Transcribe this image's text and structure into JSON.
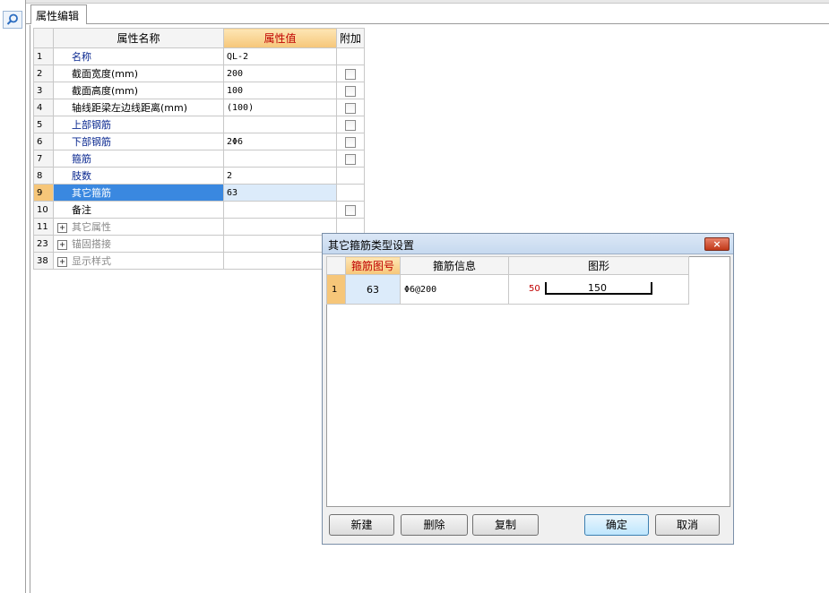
{
  "tab": {
    "label": "属性编辑"
  },
  "grid": {
    "headers": {
      "row": "",
      "name": "属性名称",
      "value": "属性值",
      "extra": "附加"
    },
    "rows": [
      {
        "no": "1",
        "name": "名称",
        "value": "QL-2",
        "checkbox": false
      },
      {
        "no": "2",
        "name": "截面宽度(mm)",
        "value": "200",
        "checkbox": true
      },
      {
        "no": "3",
        "name": "截面高度(mm)",
        "value": "100",
        "checkbox": true
      },
      {
        "no": "4",
        "name": "轴线距梁左边线距离(mm)",
        "value": "(100)",
        "checkbox": true
      },
      {
        "no": "5",
        "name": "上部钢筋",
        "value": "",
        "checkbox": true
      },
      {
        "no": "6",
        "name": "下部钢筋",
        "value": "2Φ6",
        "checkbox": true
      },
      {
        "no": "7",
        "name": "箍筋",
        "value": "",
        "checkbox": true
      },
      {
        "no": "8",
        "name": "肢数",
        "value": "2",
        "checkbox": false
      },
      {
        "no": "9",
        "name": "其它箍筋",
        "value": "63",
        "checkbox": false
      },
      {
        "no": "10",
        "name": "备注",
        "value": "",
        "checkbox": true
      },
      {
        "no": "11",
        "name": "其它属性",
        "value": "",
        "expandable": true
      },
      {
        "no": "23",
        "name": "锚固搭接",
        "value": "",
        "expandable": true
      },
      {
        "no": "38",
        "name": "显示样式",
        "value": "",
        "expandable": true
      }
    ],
    "selected_row": "9"
  },
  "dialog": {
    "title": "其它箍筋类型设置",
    "close_label": "×",
    "headers": {
      "row": "",
      "shape_no": "箍筋图号",
      "info": "箍筋信息",
      "figure": "图形"
    },
    "rows": [
      {
        "no": "1",
        "shape_no": "63",
        "info": "Φ6@200",
        "figure_left": "50",
        "figure_mid": "150"
      }
    ],
    "buttons": {
      "new": "新建",
      "delete": "删除",
      "copy": "复制",
      "ok": "确定",
      "cancel": "取消"
    }
  },
  "colors": {
    "header_accent": "#f6c679",
    "selection": "#3a88e0",
    "name_blue": "#0a2890"
  }
}
